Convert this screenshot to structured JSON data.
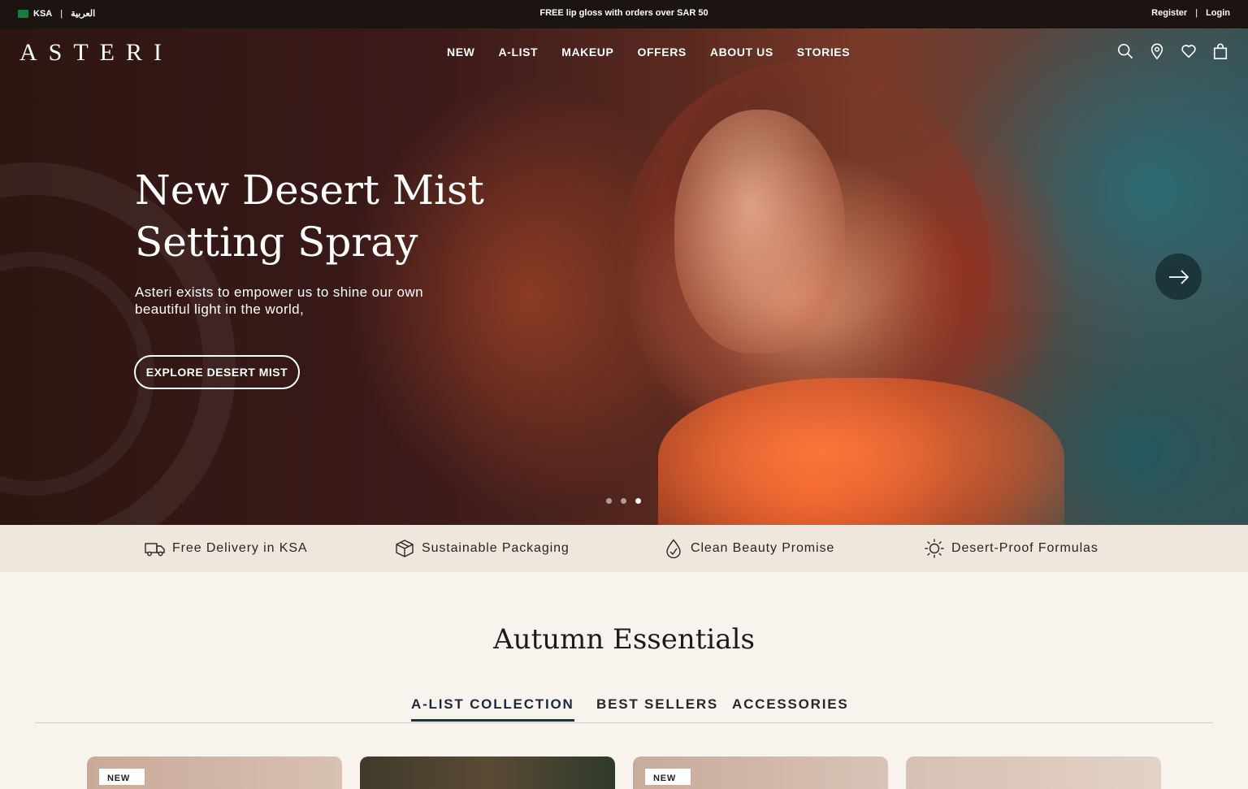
{
  "topbar": {
    "region": "KSA",
    "language_switch": "العربية",
    "promo": "FREE lip gloss with orders over SAR 50",
    "register": "Register",
    "separator": "|",
    "login": "Login"
  },
  "header": {
    "logo": "ASTERI",
    "nav": [
      "NEW",
      "A-LIST",
      "MAKEUP",
      "OFFERS",
      "ABOUT US",
      "STORIES"
    ],
    "icons": [
      "search-icon",
      "location-pin-icon",
      "heart-icon",
      "shopping-bag-icon"
    ]
  },
  "hero": {
    "title": "New Desert Mist Setting Spray",
    "subtitle": "Asteri exists to empower us to shine our own beautiful light in the world,",
    "cta": "EXPLORE DESERT MIST",
    "slide_count": 3,
    "active_slide": 3
  },
  "features": [
    {
      "icon": "delivery-truck-icon",
      "label": "Free Delivery in KSA"
    },
    {
      "icon": "package-box-icon",
      "label": "Sustainable Packaging"
    },
    {
      "icon": "water-drop-icon",
      "label": "Clean Beauty Promise"
    },
    {
      "icon": "sun-icon",
      "label": "Desert-Proof Formulas"
    }
  ],
  "section": {
    "title": "Autumn Essentials",
    "tabs": [
      "A-LIST COLLECTION",
      "BEST SELLERS",
      "ACCESSORIES"
    ],
    "active_tab": "A-LIST COLLECTION"
  },
  "products": [
    {
      "badge": "NEW"
    },
    {
      "badge": ""
    },
    {
      "badge": "NEW"
    },
    {
      "badge": ""
    }
  ],
  "colors": {
    "topbar_bg": "#1b1411",
    "feature_strip_bg": "#efe6de",
    "page_bg": "#f9f3ee",
    "active_tab_underline": "#1b3148"
  }
}
